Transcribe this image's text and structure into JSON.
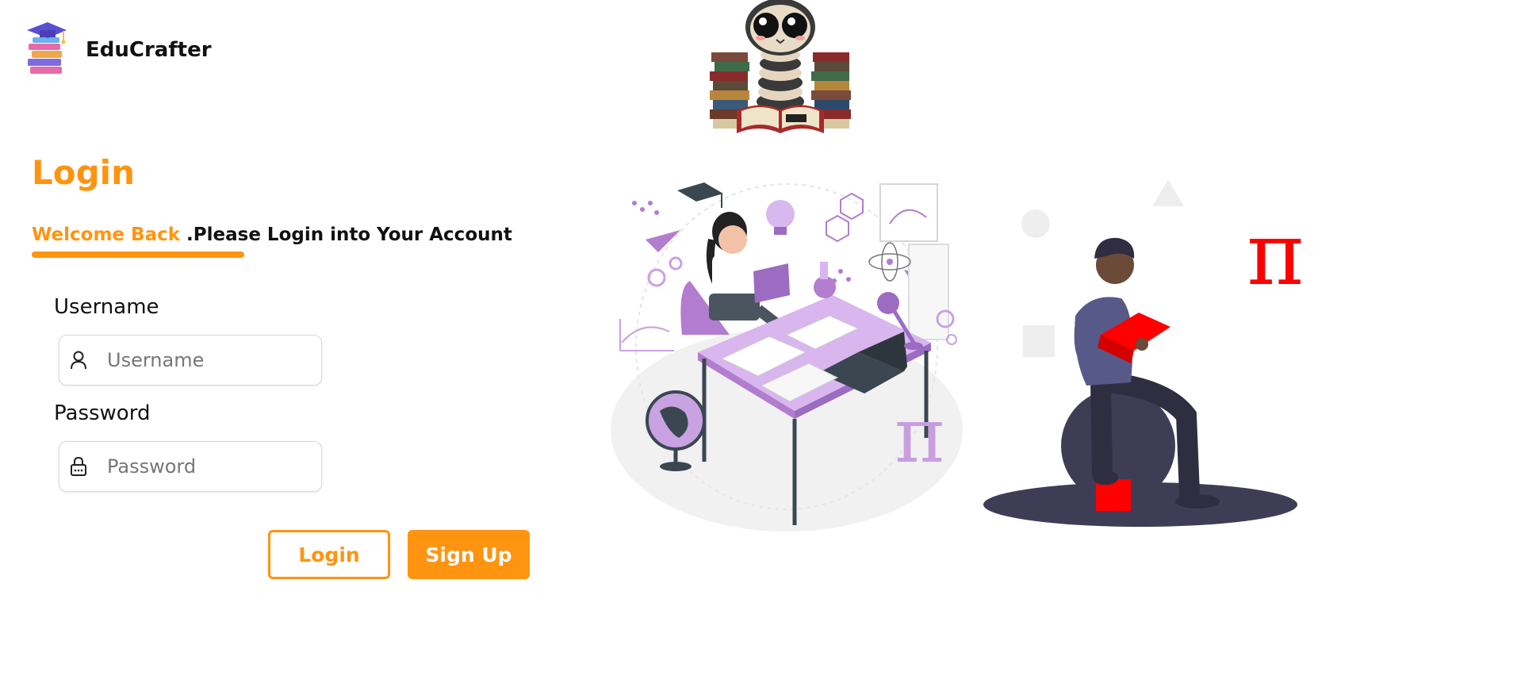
{
  "brand": {
    "name": "EduCrafter",
    "logo_icon": "book-stack-graduation-cap-icon"
  },
  "mascot": {
    "icon": "owl-reading-books-icon"
  },
  "login": {
    "title": "Login",
    "welcome_accent": "Welcome Back",
    "welcome_rest": " .Please Login into Your Account"
  },
  "username": {
    "label": "Username",
    "placeholder": "Username",
    "icon": "user-icon"
  },
  "password": {
    "label": "Password",
    "placeholder": "Password",
    "icon": "lock-icon"
  },
  "buttons": {
    "login": "Login",
    "signup": "Sign Up"
  },
  "illustrations": {
    "left": "student-studying-at-desk-illustration",
    "right": "person-reading-on-ball-illustration",
    "pi_symbol": "π"
  },
  "colors": {
    "accent": "#ff9410",
    "pi_red": "#ff0000",
    "purple": "#c89ee0"
  }
}
